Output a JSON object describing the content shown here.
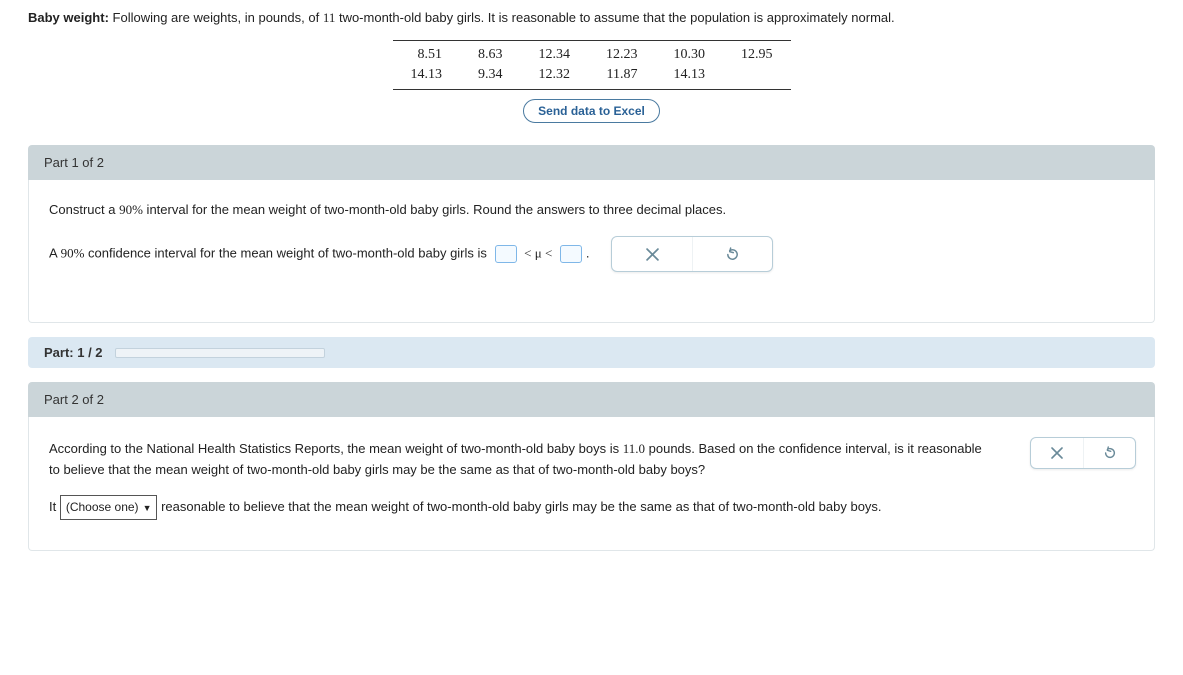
{
  "intro": {
    "label": "Baby weight:",
    "text_a": " Following are weights, in pounds, of ",
    "count": "11",
    "text_b": " two-month-old baby girls. It is reasonable to assume that the population is approximately normal."
  },
  "data_table": {
    "row1": [
      "8.51",
      "8.63",
      "12.34",
      "12.23",
      "10.30",
      "12.95"
    ],
    "row2": [
      "14.13",
      "9.34",
      "12.32",
      "11.87",
      "14.13",
      ""
    ]
  },
  "buttons": {
    "excel": "Send data to Excel"
  },
  "part1": {
    "header": "Part 1 of 2",
    "q_a": "Construct a ",
    "q_pct": "90%",
    "q_b": " interval for the mean weight of two-month-old baby girls. Round the answers to three decimal places.",
    "ans_a": "A ",
    "ans_pct": "90%",
    "ans_b": " confidence interval for the mean weight of two-month-old baby girls is ",
    "rel": "< μ <",
    "period": "."
  },
  "progress": {
    "label": "Part: 1 / 2",
    "pct": 50
  },
  "part2": {
    "header": "Part 2 of 2",
    "q_a": "According to the National Health Statistics Reports, the mean weight of two-month-old baby boys is ",
    "q_val": "11.0",
    "q_b": " pounds. Based on the confidence interval, is it reasonable to believe that the mean weight of two-month-old baby girls may be the same as that of two-month-old baby boys?",
    "ans_a": "It ",
    "select": "(Choose one)",
    "ans_b": " reasonable to believe that the mean weight of two-month-old baby girls may be the same as that of two-month-old baby boys."
  }
}
